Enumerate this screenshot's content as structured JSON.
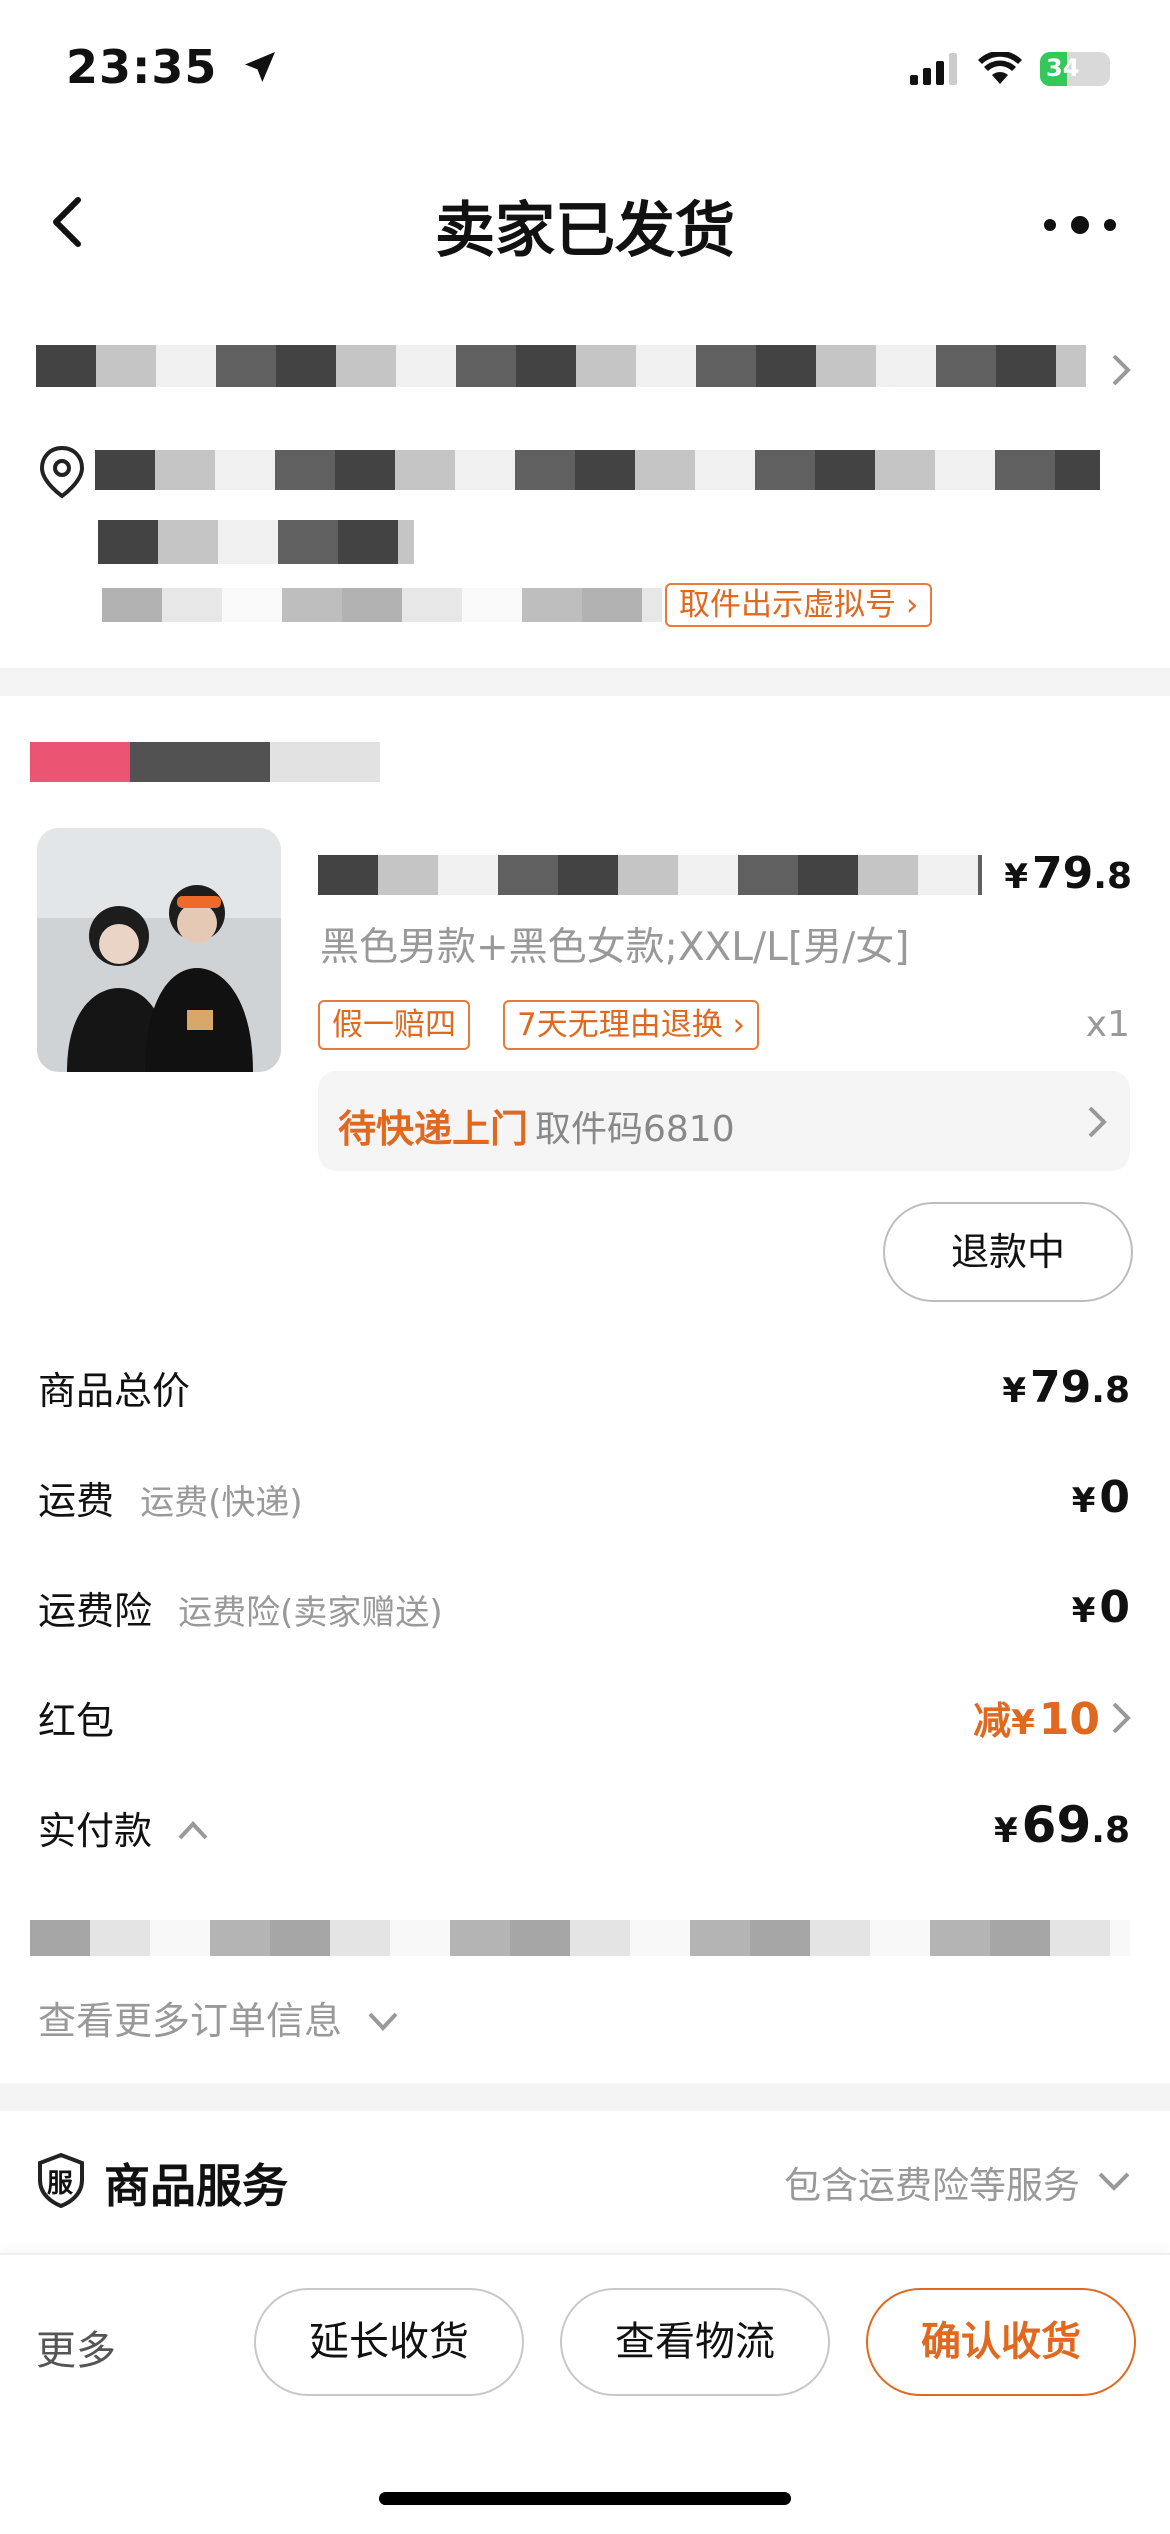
{
  "status_bar": {
    "time": "23:35",
    "battery": "34"
  },
  "header": {
    "title": "卖家已发货"
  },
  "address": {
    "virtual_number_link": "取件出示虚拟号"
  },
  "product": {
    "price": {
      "symbol": "¥",
      "int": "79",
      "dec": ".8"
    },
    "sku": "黑色男款+黑色女款;XXL/L[男/女]",
    "tags": [
      "假一赔四",
      "7天无理由退换"
    ],
    "quantity": "x1",
    "pickup": {
      "status": "待快递上门",
      "code": "取件码6810"
    },
    "refund_button": "退款中"
  },
  "summary": {
    "total": {
      "label": "商品总价",
      "symbol": "¥",
      "int": "79",
      "dec": ".8"
    },
    "shipping": {
      "label": "运费",
      "sub": "运费(快递)",
      "symbol": "¥",
      "value": "0"
    },
    "insurance": {
      "label": "运费险",
      "sub": "运费险(卖家赠送)",
      "symbol": "¥",
      "value": "0"
    },
    "red_packet": {
      "label": "红包",
      "prefix": "减",
      "symbol": "¥",
      "value": "10"
    },
    "paid": {
      "label": "实付款",
      "symbol": "¥",
      "int": "69",
      "dec": ".8"
    }
  },
  "more_info": "查看更多订单信息",
  "service": {
    "title": "商品服务",
    "badge": "服",
    "subtitle": "包含运费险等服务"
  },
  "bottom": {
    "more": "更多",
    "extend": "延长收货",
    "logistics": "查看物流",
    "confirm": "确认收货"
  },
  "colors": {
    "accent": "#e0681f",
    "text": "#111111",
    "muted": "#999999"
  }
}
